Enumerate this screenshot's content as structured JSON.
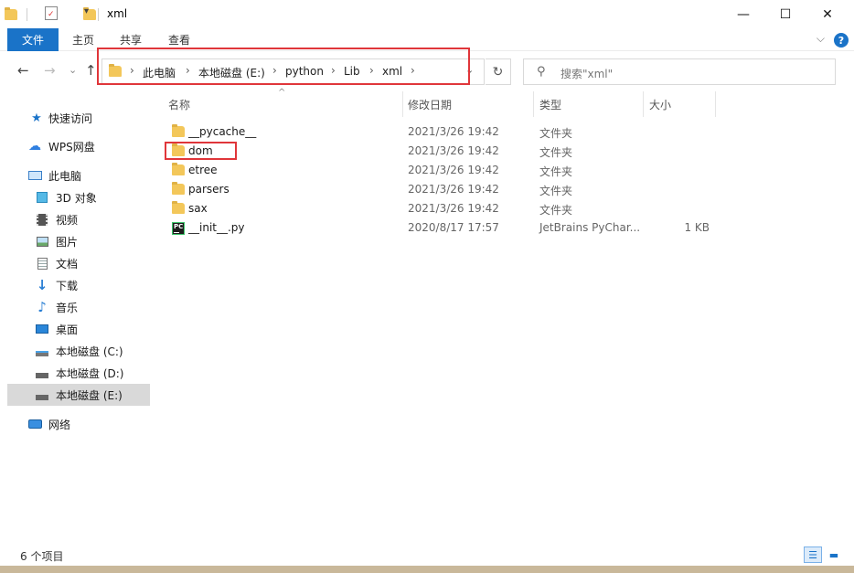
{
  "window": {
    "title": "xml",
    "minimize": "—",
    "maximize": "☐",
    "close": "✕"
  },
  "ribbon": {
    "tabs": [
      "文件",
      "主页",
      "共享",
      "查看"
    ],
    "help": "?",
    "collapse": "⌵"
  },
  "nav": {
    "back": "←",
    "forward": "→",
    "recent": "⌄",
    "up": "↑",
    "breadcrumb": [
      "此电脑",
      "本地磁盘 (E:)",
      "python",
      "Lib",
      "xml"
    ],
    "separator": "›",
    "dropdown": "⌄",
    "refresh": "↻"
  },
  "search": {
    "placeholder": "搜索\"xml\""
  },
  "sidebar": {
    "items": [
      {
        "label": "快速访问",
        "icon": "star-icon"
      },
      {
        "label": "WPS网盘",
        "icon": "cloud-icon"
      },
      {
        "label": "此电脑",
        "icon": "computer-icon"
      },
      {
        "label": "3D 对象",
        "icon": "cube-icon"
      },
      {
        "label": "视频",
        "icon": "video-icon"
      },
      {
        "label": "图片",
        "icon": "picture-icon"
      },
      {
        "label": "文档",
        "icon": "document-icon"
      },
      {
        "label": "下载",
        "icon": "download-icon"
      },
      {
        "label": "音乐",
        "icon": "music-icon"
      },
      {
        "label": "桌面",
        "icon": "desktop-icon"
      },
      {
        "label": "本地磁盘 (C:)",
        "icon": "drive-icon"
      },
      {
        "label": "本地磁盘 (D:)",
        "icon": "drive-icon"
      },
      {
        "label": "本地磁盘 (E:)",
        "icon": "drive-icon"
      },
      {
        "label": "网络",
        "icon": "network-icon"
      }
    ],
    "selected": "本地磁盘 (E:)"
  },
  "columns": {
    "name": "名称",
    "date": "修改日期",
    "type": "类型",
    "size": "大小"
  },
  "files": [
    {
      "name": "__pycache__",
      "date": "2021/3/26 19:42",
      "type": "文件夹",
      "size": "",
      "icon": "folder-icon"
    },
    {
      "name": "dom",
      "date": "2021/3/26 19:42",
      "type": "文件夹",
      "size": "",
      "icon": "folder-icon"
    },
    {
      "name": "etree",
      "date": "2021/3/26 19:42",
      "type": "文件夹",
      "size": "",
      "icon": "folder-icon"
    },
    {
      "name": "parsers",
      "date": "2021/3/26 19:42",
      "type": "文件夹",
      "size": "",
      "icon": "folder-icon"
    },
    {
      "name": "sax",
      "date": "2021/3/26 19:42",
      "type": "文件夹",
      "size": "",
      "icon": "folder-icon"
    },
    {
      "name": "__init__.py",
      "date": "2020/8/17 17:57",
      "type": "JetBrains PyChar...",
      "size": "1 KB",
      "icon": "pycharm-file-icon",
      "icon_text": "PC"
    }
  ],
  "status": {
    "count": "6 个项目"
  },
  "colors": {
    "accent": "#1a73c8",
    "highlight_box": "#e0363a",
    "folder": "#f3c75a",
    "selected_bg": "#d9d9d9"
  }
}
